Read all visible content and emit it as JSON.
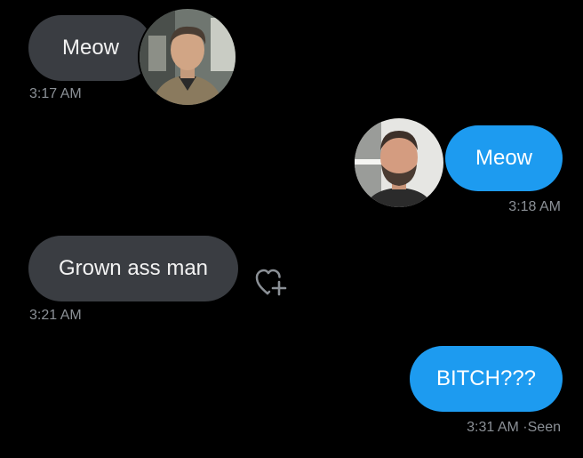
{
  "messages": [
    {
      "text": "Meow",
      "time": "3:17 AM",
      "direction": "received",
      "avatar": "man-in-jacket-avatar"
    },
    {
      "text": "Meow",
      "time": "3:18 AM",
      "direction": "sent",
      "avatar": "bearded-man-avatar"
    },
    {
      "text": "Grown ass man",
      "time": "3:21 AM",
      "direction": "received",
      "reaction_icon": "heart-plus-icon"
    },
    {
      "text": "BITCH???",
      "time": "3:31 AM",
      "direction": "sent",
      "status": "Seen"
    }
  ],
  "colors": {
    "background": "#000000",
    "received_bubble": "#3a3d42",
    "sent_bubble": "#1d9bf0",
    "timestamp": "#8b9096"
  }
}
